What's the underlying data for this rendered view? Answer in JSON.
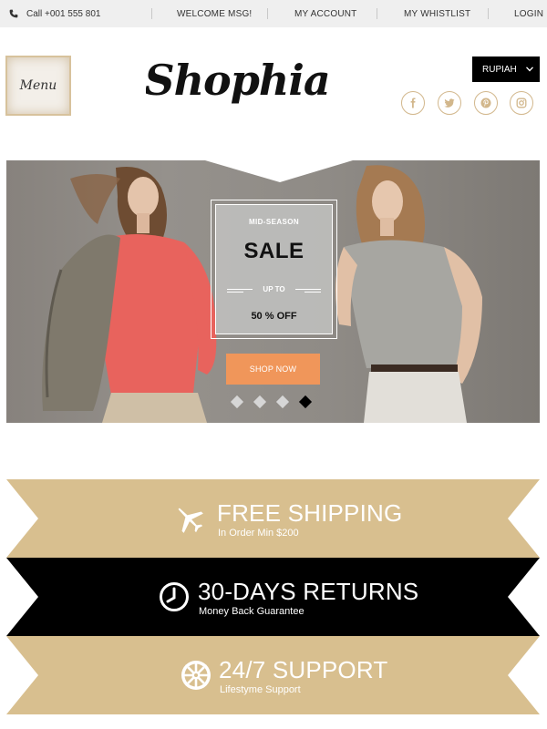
{
  "topbar": {
    "phone": "Call +001 555 801",
    "links": [
      "WELCOME MSG!",
      "MY ACCOUNT",
      "MY WHISTLIST",
      "LOGIN"
    ]
  },
  "header": {
    "menu_label": "Menu",
    "logo_text": "Shophia",
    "currency": "RUPIAH",
    "social_icons": [
      "facebook-icon",
      "twitter-icon",
      "pinterest-icon",
      "instagram-icon"
    ]
  },
  "hero": {
    "eyebrow": "MID-SEASON",
    "title": "SALE",
    "upto": "UP TO",
    "discount": "50 % OFF",
    "cta": "SHOP NOW",
    "slides": 4,
    "active_slide": 4
  },
  "features": [
    {
      "title": "FREE SHIPPING",
      "subtitle": "In Order Min $200",
      "icon": "airplane-icon"
    },
    {
      "title": "30-DAYS RETURNS",
      "subtitle": "Money Back Guarantee",
      "icon": "clock-icon"
    },
    {
      "title": "24/7 SUPPORT",
      "subtitle": "Lifestyme Support",
      "icon": "support-emblem-icon"
    }
  ],
  "colors": {
    "accent_tan": "#d8bf8f",
    "cta_orange": "#f0965a",
    "black": "#000000",
    "topbar_bg": "#efefef"
  }
}
